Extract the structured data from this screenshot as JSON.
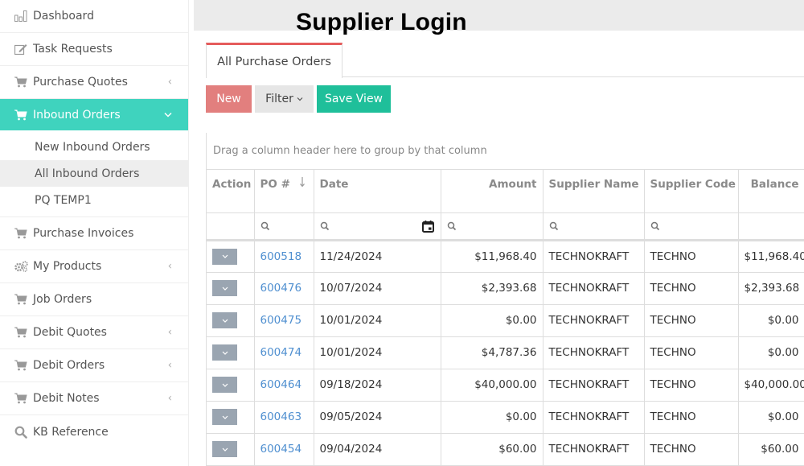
{
  "header": {
    "title": "Supplier Login"
  },
  "sidebar": {
    "items": [
      {
        "label": "Dashboard",
        "icon": "bar-chart-icon",
        "has_chevron": false
      },
      {
        "label": "Task Requests",
        "icon": "edit-icon",
        "has_chevron": false
      },
      {
        "label": "Purchase Quotes",
        "icon": "cart-icon",
        "has_chevron": true,
        "chevron": "‹"
      },
      {
        "label": "Inbound Orders",
        "icon": "cart-icon",
        "has_chevron": true,
        "chevron": "⌄",
        "active": true
      },
      {
        "label": "Purchase Invoices",
        "icon": "cart-icon",
        "has_chevron": false
      },
      {
        "label": "My Products",
        "icon": "gears-icon",
        "has_chevron": true,
        "chevron": "‹"
      },
      {
        "label": "Job Orders",
        "icon": "cart-icon",
        "has_chevron": false
      },
      {
        "label": "Debit Quotes",
        "icon": "cart-icon",
        "has_chevron": true,
        "chevron": "‹"
      },
      {
        "label": "Debit Orders",
        "icon": "cart-icon",
        "has_chevron": true,
        "chevron": "‹"
      },
      {
        "label": "Debit Notes",
        "icon": "cart-icon",
        "has_chevron": true,
        "chevron": "‹"
      },
      {
        "label": "KB Reference",
        "icon": "search-icon",
        "has_chevron": false
      }
    ],
    "submenu": [
      {
        "label": "New Inbound Orders"
      },
      {
        "label": "All Inbound Orders",
        "selected": true
      },
      {
        "label": "PQ TEMP1"
      }
    ],
    "active_color": "#3fd3be"
  },
  "tabs": [
    {
      "label": "All Purchase Orders",
      "active": true
    }
  ],
  "toolbar": {
    "new_label": "New",
    "filter_label": "Filter",
    "filter_caret": "⌄",
    "save_view_label": "Save View",
    "colors": {
      "new": "#e27f7e",
      "filter": "#e6e6e6",
      "save_view": "#1fbf9a"
    }
  },
  "grid": {
    "group_panel_text": "Drag a column header here to group by that column",
    "columns": [
      {
        "label": "Action",
        "align": "left",
        "filter": "none"
      },
      {
        "label": "PO #",
        "align": "left",
        "filter": "search",
        "sort": "descending"
      },
      {
        "label": "Date",
        "align": "left",
        "filter": "search-date"
      },
      {
        "label": "Amount",
        "align": "right",
        "filter": "search"
      },
      {
        "label": "Supplier Name",
        "align": "left",
        "filter": "search"
      },
      {
        "label": "Supplier Code",
        "align": "left",
        "filter": "search"
      },
      {
        "label": "Balance",
        "align": "right",
        "filter": "none"
      }
    ],
    "rows": [
      {
        "po": "600518",
        "date": "11/24/2024",
        "amount": "$11,968.40",
        "supplier_name": "TECHNOKRAFT",
        "supplier_code": "TECHNO",
        "balance": "$11,968.40"
      },
      {
        "po": "600476",
        "date": "10/07/2024",
        "amount": "$2,393.68",
        "supplier_name": "TECHNOKRAFT",
        "supplier_code": "TECHNO",
        "balance": "$2,393.68"
      },
      {
        "po": "600475",
        "date": "10/01/2024",
        "amount": "$0.00",
        "supplier_name": "TECHNOKRAFT",
        "supplier_code": "TECHNO",
        "balance": "$0.00"
      },
      {
        "po": "600474",
        "date": "10/01/2024",
        "amount": "$4,787.36",
        "supplier_name": "TECHNOKRAFT",
        "supplier_code": "TECHNO",
        "balance": "$0.00"
      },
      {
        "po": "600464",
        "date": "09/18/2024",
        "amount": "$40,000.00",
        "supplier_name": "TECHNOKRAFT",
        "supplier_code": "TECHNO",
        "balance": "$40,000.00"
      },
      {
        "po": "600463",
        "date": "09/05/2024",
        "amount": "$0.00",
        "supplier_name": "TECHNOKRAFT",
        "supplier_code": "TECHNO",
        "balance": "$0.00"
      },
      {
        "po": "600454",
        "date": "09/04/2024",
        "amount": "$60.00",
        "supplier_name": "TECHNOKRAFT",
        "supplier_code": "TECHNO",
        "balance": "$60.00"
      }
    ],
    "link_color": "#4f8fd0"
  }
}
